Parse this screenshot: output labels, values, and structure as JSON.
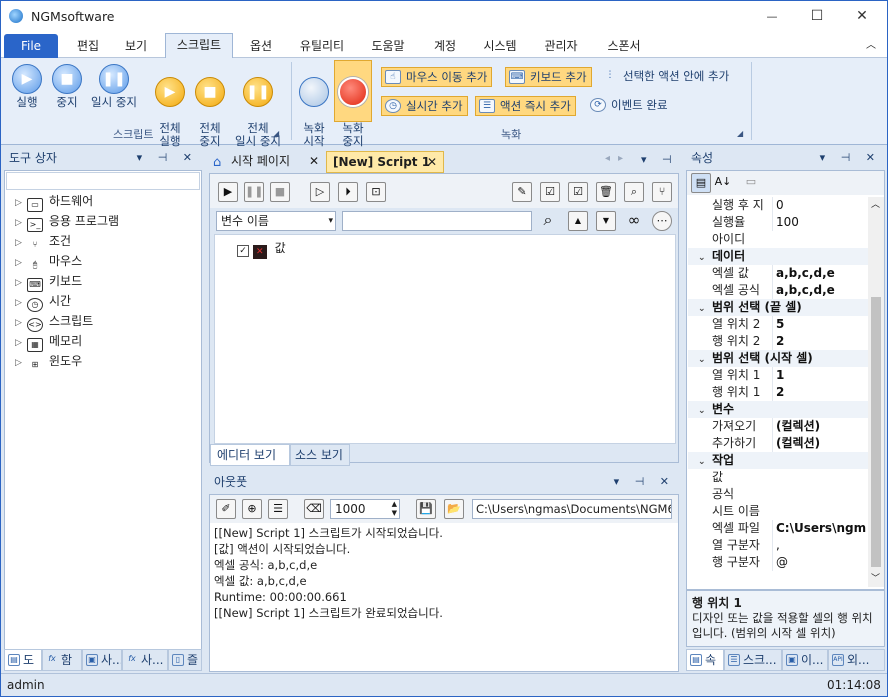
{
  "app": {
    "title": "NGMsoftware"
  },
  "window_buttons": {
    "minimize": "—",
    "maximize": "☐",
    "close": "✕"
  },
  "menu": [
    "File",
    "편집",
    "보기",
    "스크립트",
    "옵션",
    "유틸리티",
    "도움말",
    "계정",
    "시스템",
    "관리자",
    "스폰서"
  ],
  "ribbon": {
    "script_group": {
      "label": "스크립트",
      "buttons": [
        "실행",
        "중지",
        "일시 중지",
        "전체\n실행",
        "전체\n중지",
        "전체\n일시 중지"
      ]
    },
    "record_group": {
      "label": "녹화",
      "buttons": [
        "녹화\n시작",
        "녹화\n중지"
      ],
      "small": [
        "마우스 이동 추가",
        "키보드 추가",
        "선택한 액션 안에 추가",
        "실시간 추가",
        "액션 즉시 추가",
        "이벤트 완료"
      ]
    }
  },
  "toolbox": {
    "title": "도구 상자",
    "items": [
      "하드웨어",
      "응용 프로그램",
      "조건",
      "마우스",
      "키보드",
      "시간",
      "스크립트",
      "메모리",
      "윈도우"
    ],
    "bottom_tabs": [
      "도",
      "함",
      "사...",
      "사...",
      "즐"
    ]
  },
  "editor": {
    "tabs": [
      "시작 페이지",
      "[New] Script 1"
    ],
    "variable_select": "변수 이름",
    "tree_node": "값",
    "bottom_tabs": [
      "에디터 보기",
      "소스 보기"
    ]
  },
  "output": {
    "title": "아웃풋",
    "count": "1000",
    "path": "C:\\Users\\ngmas\\Documents\\NGM6\\",
    "lines": [
      "[[New] Script 1] 스크립트가 시작되었습니다.",
      "[값] 액션이 시작되었습니다.",
      "엑셀 공식: a,b,c,d,e",
      "엑셀 값: a,b,c,d,e",
      "Runtime: 00:00:00.661",
      "[[New] Script 1] 스크립트가 완료되었습니다."
    ]
  },
  "properties": {
    "title": "속성",
    "rows": [
      {
        "kind": "prop",
        "k": "실행 후 지",
        "v": "0"
      },
      {
        "kind": "prop",
        "k": "실행율",
        "v": "100"
      },
      {
        "kind": "prop",
        "k": "아이디",
        "v": ""
      },
      {
        "kind": "cat",
        "k": "데이터"
      },
      {
        "kind": "prop",
        "k": "엑셀 값",
        "v": "a,b,c,d,e",
        "bold": true
      },
      {
        "kind": "prop",
        "k": "엑셀 공식",
        "v": "a,b,c,d,e",
        "bold": true
      },
      {
        "kind": "cat",
        "k": "범위 선택 (끝 셀)"
      },
      {
        "kind": "prop",
        "k": "열 위치 2",
        "v": "5",
        "bold": true
      },
      {
        "kind": "prop",
        "k": "행 위치 2",
        "v": "2",
        "bold": true
      },
      {
        "kind": "cat",
        "k": "범위 선택 (시작 셀)"
      },
      {
        "kind": "prop",
        "k": "열 위치 1",
        "v": "1",
        "bold": true
      },
      {
        "kind": "prop",
        "k": "행 위치 1",
        "v": "2",
        "bold": true
      },
      {
        "kind": "cat",
        "k": "변수"
      },
      {
        "kind": "prop",
        "k": "가져오기",
        "v": "(컬렉션)",
        "bold": true
      },
      {
        "kind": "prop",
        "k": "추가하기",
        "v": "(컬렉션)",
        "bold": true
      },
      {
        "kind": "cat",
        "k": "작업"
      },
      {
        "kind": "prop",
        "k": "값",
        "v": ""
      },
      {
        "kind": "prop",
        "k": "공식",
        "v": ""
      },
      {
        "kind": "prop",
        "k": "시트 이름",
        "v": ""
      },
      {
        "kind": "prop",
        "k": "엑셀 파일",
        "v": "C:\\Users\\ngm",
        "bold": true
      },
      {
        "kind": "prop",
        "k": "열 구분자",
        "v": ","
      },
      {
        "kind": "prop",
        "k": "행 구분자",
        "v": "@"
      }
    ],
    "desc_title": "행 위치 1",
    "desc_text": "디자인 또는 값을 적용할 셀의 행 위치입니다. (범위의 시작 셀 위치)",
    "bottom_tabs": [
      "속",
      "스크...",
      "이...",
      "외..."
    ]
  },
  "status": {
    "user": "admin",
    "time": "01:14:08"
  },
  "colors": {
    "accent": "#2a65c9",
    "record_highlight": "#ffd880",
    "chrome": "#dde7f3"
  }
}
